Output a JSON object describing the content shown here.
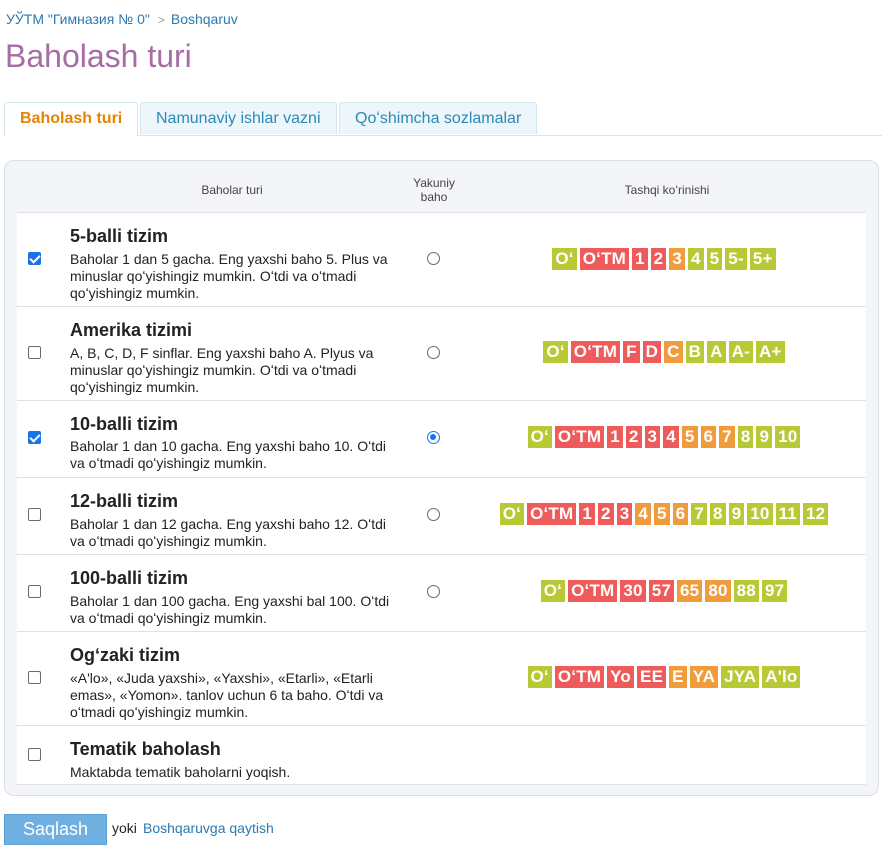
{
  "breadcrumb": {
    "school": "УЎТМ \"Гимназия № 0\"",
    "separator": ">",
    "section": "Boshqaruv"
  },
  "page_title": "Baholash turi",
  "tabs": [
    {
      "label": "Baholash turi",
      "active": true
    },
    {
      "label": "Namunaviy ishlar vazni",
      "active": false
    },
    {
      "label": "Qoʻshimcha sozlamalar",
      "active": false
    }
  ],
  "table": {
    "headers": {
      "type": "Baholar turi",
      "final": "Yakuniy baho",
      "appearance": "Tashqi koʻrinishi"
    },
    "rows": [
      {
        "name": "5-balli tizim",
        "desc": "Baholar 1 dan 5 gacha. Eng yaxshi baho 5. Plus va minuslar qoʻyishingiz mumkin. Oʻtdi va oʻtmadi qoʻyishingiz mumkin.",
        "checked": true,
        "final": false,
        "badges": [
          {
            "t": "Oʻ",
            "c": "g"
          },
          {
            "t": "OʻTM",
            "c": "r"
          },
          {
            "t": "1",
            "c": "r"
          },
          {
            "t": "2",
            "c": "r"
          },
          {
            "t": "3",
            "c": "o"
          },
          {
            "t": "4",
            "c": "g"
          },
          {
            "t": "5",
            "c": "g"
          },
          {
            "t": "5-",
            "c": "g"
          },
          {
            "t": "5+",
            "c": "g"
          }
        ]
      },
      {
        "name": "Amerika tizimi",
        "desc": "A, B, C, D, F sinflar. Eng yaxshi baho A. Plyus va minuslar qoʻyishingiz mumkin. Oʻtdi va oʻtmadi qoʻyishingiz mumkin.",
        "checked": false,
        "final": false,
        "badges": [
          {
            "t": "Oʻ",
            "c": "g"
          },
          {
            "t": "OʻTM",
            "c": "r"
          },
          {
            "t": "F",
            "c": "r"
          },
          {
            "t": "D",
            "c": "r"
          },
          {
            "t": "C",
            "c": "o"
          },
          {
            "t": "B",
            "c": "g"
          },
          {
            "t": "A",
            "c": "g"
          },
          {
            "t": "A-",
            "c": "g"
          },
          {
            "t": "A+",
            "c": "g"
          }
        ]
      },
      {
        "name": "10-balli tizim",
        "desc": "Baholar 1 dan 10 gacha. Eng yaxshi baho 10. Oʻtdi va oʻtmadi qoʻyishingiz mumkin.",
        "checked": true,
        "final": true,
        "badges": [
          {
            "t": "Oʻ",
            "c": "g"
          },
          {
            "t": "OʻTM",
            "c": "r"
          },
          {
            "t": "1",
            "c": "r"
          },
          {
            "t": "2",
            "c": "r"
          },
          {
            "t": "3",
            "c": "r"
          },
          {
            "t": "4",
            "c": "r"
          },
          {
            "t": "5",
            "c": "o"
          },
          {
            "t": "6",
            "c": "o"
          },
          {
            "t": "7",
            "c": "o"
          },
          {
            "t": "8",
            "c": "g"
          },
          {
            "t": "9",
            "c": "g"
          },
          {
            "t": "10",
            "c": "g"
          }
        ]
      },
      {
        "name": "12-balli tizim",
        "desc": "Baholar 1 dan 12 gacha. Eng yaxshi baho 12. Oʻtdi va oʻtmadi qoʻyishingiz mumkin.",
        "checked": false,
        "final": false,
        "badges": [
          {
            "t": "Oʻ",
            "c": "g"
          },
          {
            "t": "OʻTM",
            "c": "r"
          },
          {
            "t": "1",
            "c": "r"
          },
          {
            "t": "2",
            "c": "r"
          },
          {
            "t": "3",
            "c": "r"
          },
          {
            "t": "4",
            "c": "o"
          },
          {
            "t": "5",
            "c": "o"
          },
          {
            "t": "6",
            "c": "o"
          },
          {
            "t": "7",
            "c": "g"
          },
          {
            "t": "8",
            "c": "g"
          },
          {
            "t": "9",
            "c": "g"
          },
          {
            "t": "10",
            "c": "g"
          },
          {
            "t": "11",
            "c": "g"
          },
          {
            "t": "12",
            "c": "g"
          }
        ]
      },
      {
        "name": "100-balli tizim",
        "desc": "Baholar 1 dan 100 gacha. Eng yaxshi bal 100. Oʻtdi va oʻtmadi qoʻyishingiz mumkin.",
        "checked": false,
        "final": false,
        "badges": [
          {
            "t": "Oʻ",
            "c": "g"
          },
          {
            "t": "OʻTM",
            "c": "r"
          },
          {
            "t": "30",
            "c": "r"
          },
          {
            "t": "57",
            "c": "r"
          },
          {
            "t": "65",
            "c": "o"
          },
          {
            "t": "80",
            "c": "o"
          },
          {
            "t": "88",
            "c": "g"
          },
          {
            "t": "97",
            "c": "g"
          }
        ]
      },
      {
        "name": "Ogʻzaki tizim",
        "desc": "«A'lo», «Juda yaxshi», «Yaxshi», «Etarli», «Etarli emas», «Yomon». tanlov uchun 6 ta baho. Oʻtdi va oʻtmadi qoʻyishingiz mumkin.",
        "checked": false,
        "final": false,
        "badges": [
          {
            "t": "Oʻ",
            "c": "g"
          },
          {
            "t": "OʻTM",
            "c": "r"
          },
          {
            "t": "Yo",
            "c": "r"
          },
          {
            "t": "EE",
            "c": "r"
          },
          {
            "t": "E",
            "c": "o"
          },
          {
            "t": "YA",
            "c": "o"
          },
          {
            "t": "JYA",
            "c": "g"
          },
          {
            "t": "A'lo",
            "c": "g"
          }
        ]
      },
      {
        "name": "Tematik baholash",
        "desc": "Maktabda tematik baholarni yoqish.",
        "checked": false,
        "final": null,
        "badges": []
      }
    ]
  },
  "colors": {
    "green": "#b8c935",
    "red": "#ef5a5a",
    "orange": "#f09c3c",
    "title": "#a66ca6",
    "link": "#2a7ab0"
  },
  "footer": {
    "save_label": "Saqlash",
    "or_text": "yoki",
    "back_link": "Boshqaruvga qaytish"
  }
}
